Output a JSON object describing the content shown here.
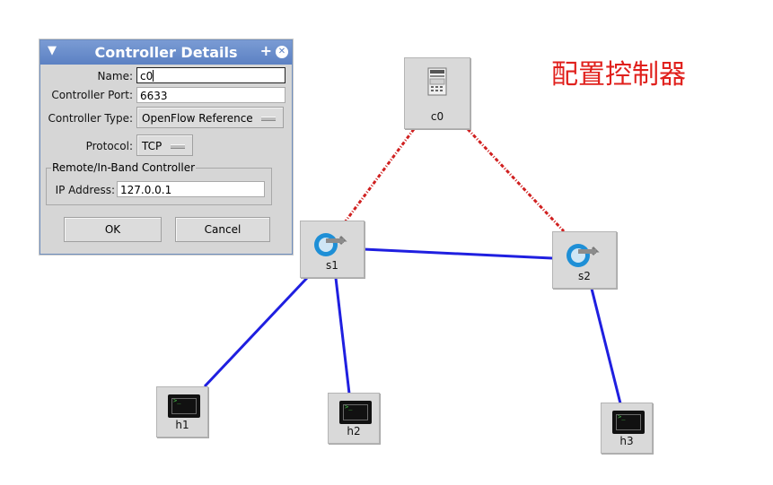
{
  "annotation": "配置控制器",
  "colors": {
    "link": "#1f1fe0",
    "control_link": "#d02020",
    "titlebar": "#5c81c3",
    "annotation": "#e0201c"
  },
  "nodes": {
    "c0": {
      "label": "c0",
      "icon": "server-icon"
    },
    "s1": {
      "label": "s1",
      "icon": "switch-icon"
    },
    "s2": {
      "label": "s2",
      "icon": "switch-icon"
    },
    "h1": {
      "label": "h1",
      "icon": "terminal-icon"
    },
    "h2": {
      "label": "h2",
      "icon": "terminal-icon"
    },
    "h3": {
      "label": "h3",
      "icon": "terminal-icon"
    }
  },
  "dialog": {
    "title": "Controller Details",
    "name_label": "Name:",
    "name_value": "c0",
    "port_label": "Controller Port:",
    "port_value": "6633",
    "type_label": "Controller Type:",
    "type_value": "OpenFlow Reference",
    "protocol_label": "Protocol:",
    "protocol_value": "TCP",
    "group_title": "Remote/In-Band Controller",
    "ip_label": "IP Address:",
    "ip_value": "127.0.0.1",
    "ok_label": "OK",
    "cancel_label": "Cancel"
  }
}
